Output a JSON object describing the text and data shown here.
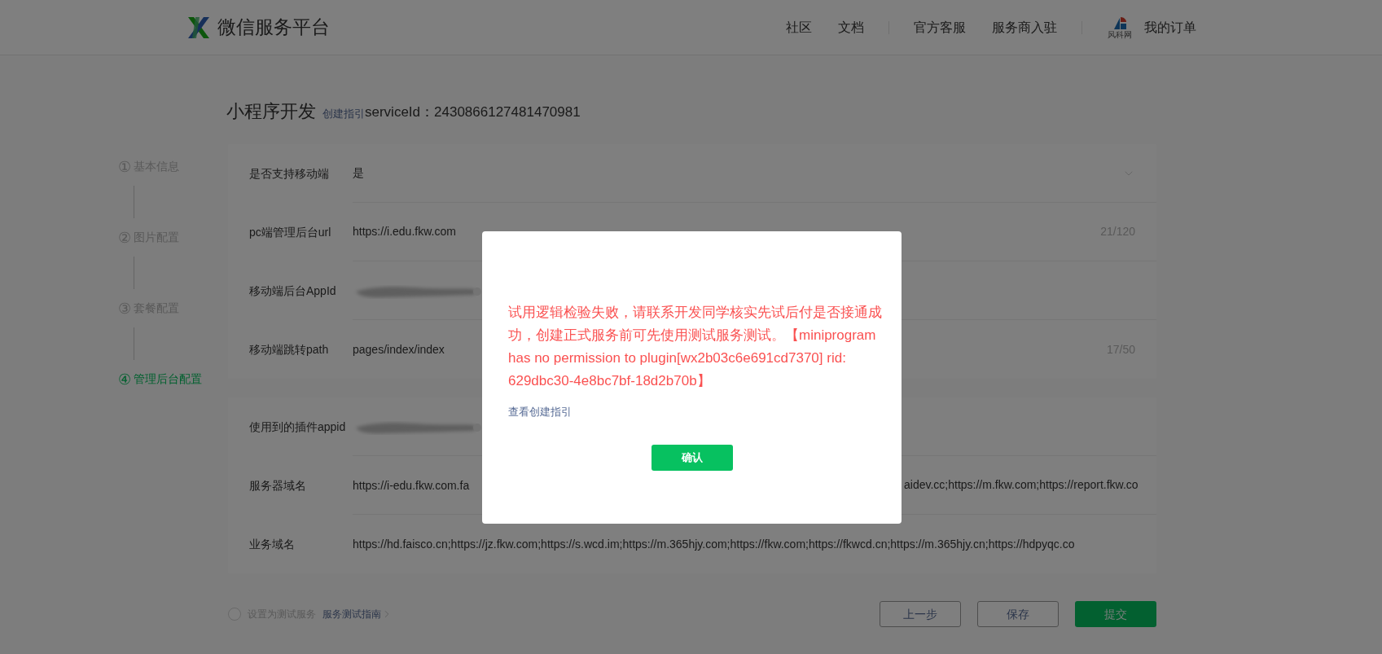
{
  "header": {
    "brand": "微信服务平台",
    "nav_groups": [
      {
        "links": [
          {
            "label": "社区"
          },
          {
            "label": "文档"
          }
        ]
      },
      {
        "links": [
          {
            "label": "官方客服"
          },
          {
            "label": "服务商入驻"
          }
        ]
      }
    ],
    "account_logo_caption": "风科网",
    "account_link": "我的订单"
  },
  "page_title": "小程序开发",
  "guide_link": "创建指引",
  "service_id": "serviceId：2430866127481470981",
  "steps": [
    {
      "number": "①",
      "label": "基本信息",
      "selected": false
    },
    {
      "number": "②",
      "label": "图片配置",
      "selected": false
    },
    {
      "number": "③",
      "label": "套餐配置",
      "selected": false
    },
    {
      "number": "④",
      "label": "管理后台配置",
      "selected": true
    }
  ],
  "sections": [
    {
      "rows": [
        {
          "kind": "select",
          "label": "是否支持移动端",
          "value": "是"
        },
        {
          "kind": "text",
          "label": "pc端管理后台url",
          "value": "https://i.edu.fkw.com",
          "count": "21/120"
        },
        {
          "kind": "redacted",
          "label": "移动端后台AppId"
        },
        {
          "kind": "text",
          "label": "移动端跳转path",
          "value": "pages/index/index",
          "count": "17/50"
        }
      ]
    },
    {
      "rows": [
        {
          "kind": "redacted",
          "label": "使用到的插件appid"
        },
        {
          "kind": "split",
          "label": "服务器域名",
          "value": "https://i-edu.fkw.com.fa",
          "value_tail": "aidev.cc;https://m.fkw.com;https://report.fkw.co"
        },
        {
          "kind": "plain",
          "label": "业务域名",
          "value": "https://hd.faisco.cn;https://jz.fkw.com;https://s.wcd.im;https://m.365hjy.com;https://fkw.com;https://fkwcd.cn;https://m.365hjy.cn;https://hdpyqc.co"
        }
      ]
    }
  ],
  "test_service": {
    "label": "设置为测试服务",
    "checked": false,
    "guide_link": "服务测试指南"
  },
  "buttons": [
    {
      "label": "上一步",
      "kind": "outline"
    },
    {
      "label": "保存",
      "kind": "outline"
    },
    {
      "label": "提交",
      "kind": "primary"
    }
  ],
  "dialog": {
    "message": "试用逻辑检验失败，请联系开发同学核实先试后付是否接通成功，创建正式服务前可先使用测试服务测试。【miniprogram has no permission to plugin[wx2b03c6e691cd7370] rid: 629dbc30-4e8bc7bf-18d2b70b】",
    "guide_link": "查看创建指引",
    "confirm": "确认"
  }
}
